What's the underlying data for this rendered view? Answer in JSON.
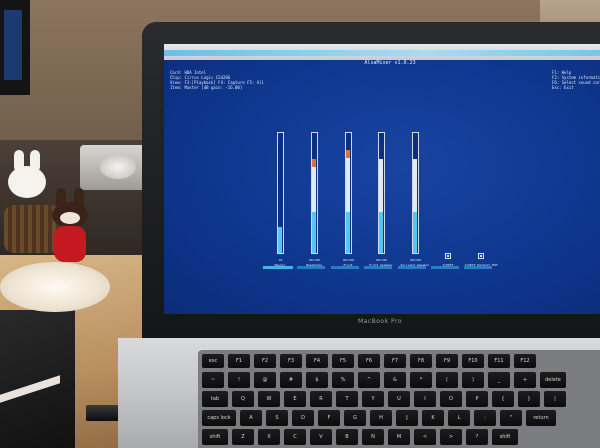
{
  "laptop": {
    "brand_label": "MacBook Pro"
  },
  "app": {
    "title": "AlsaMixer v1.0.23",
    "info": [
      {
        "key": "Card:",
        "value": "HDA Intel"
      },
      {
        "key": "Chip:",
        "value": "Cirrus Logic CS4206"
      },
      {
        "key": "View:",
        "value": "F3:[Playback] F4: Capture  F5: All"
      },
      {
        "key": "Item:",
        "value": "Master [dB gain: -16.00]"
      }
    ],
    "help": [
      {
        "key": "F1:",
        "value": "Help"
      },
      {
        "key": "F2:",
        "value": "System information"
      },
      {
        "key": "F6:",
        "value": "Select sound card"
      },
      {
        "key": "Esc:",
        "value": "Exit"
      }
    ],
    "channels": [
      {
        "name": "Master",
        "value": "44",
        "level": 0.22,
        "peak": 0.0,
        "kind": "slider"
      },
      {
        "name": "Headphone",
        "value": "00<>00",
        "level": 0.78,
        "peak": 0.07,
        "kind": "slider"
      },
      {
        "name": "Front",
        "value": "00<>00",
        "level": 0.86,
        "peak": 0.07,
        "kind": "slider"
      },
      {
        "name": "Front Speaker",
        "value": "00<>00",
        "level": 0.78,
        "peak": 0.0,
        "kind": "slider"
      },
      {
        "name": "Surround Speaker",
        "value": "00<>00",
        "level": 0.78,
        "peak": 0.0,
        "kind": "slider"
      },
      {
        "name": "S/PDIF",
        "value": "",
        "level": 0,
        "peak": 0,
        "kind": "switch"
      },
      {
        "name": "S/PDIF Default PCM",
        "value": "",
        "level": 0,
        "peak": 0,
        "kind": "switch"
      }
    ]
  },
  "keyboard": {
    "rows": [
      [
        "esc",
        "F1",
        "F2",
        "F3",
        "F4",
        "F5",
        "F6",
        "F7",
        "F8",
        "F9",
        "F10",
        "F11",
        "F12"
      ],
      [
        "~",
        "!",
        "@",
        "#",
        "$",
        "%",
        "^",
        "&",
        "*",
        "(",
        ")",
        "_",
        "+",
        "delete"
      ],
      [
        "tab",
        "Q",
        "W",
        "E",
        "R",
        "T",
        "Y",
        "U",
        "I",
        "O",
        "P",
        "{",
        "}",
        "|"
      ],
      [
        "caps lock",
        "A",
        "S",
        "D",
        "F",
        "G",
        "H",
        "J",
        "K",
        "L",
        ":",
        "\"",
        "return"
      ],
      [
        "shift",
        "Z",
        "X",
        "C",
        "V",
        "B",
        "N",
        "M",
        "<",
        ">",
        "?",
        "shift"
      ]
    ]
  },
  "colors": {
    "screen_bg": "#0f3790",
    "bar_fill": "#dfe9f7",
    "bar_peak": "#e66d3b",
    "strip": "#45b2e6"
  }
}
